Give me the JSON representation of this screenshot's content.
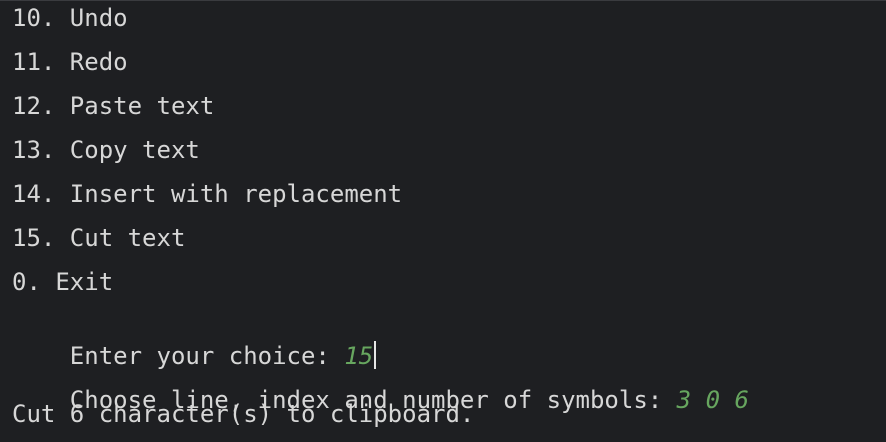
{
  "console": {
    "menu": [
      "10. Undo",
      "11. Redo",
      "12. Paste text",
      "13. Copy text",
      "14. Insert with replacement",
      "15. Cut text",
      "0. Exit"
    ],
    "choice_prompt": "Enter your choice: ",
    "choice_input": "15",
    "symbols_prompt": "Choose line, index and number of symbols: ",
    "symbols_input": "3 0 6",
    "result": "Cut 6 character(s) to clipboard."
  },
  "colors": {
    "background": "#1e1f22",
    "text": "#d7d7d7",
    "user_input": "#67a65f"
  }
}
